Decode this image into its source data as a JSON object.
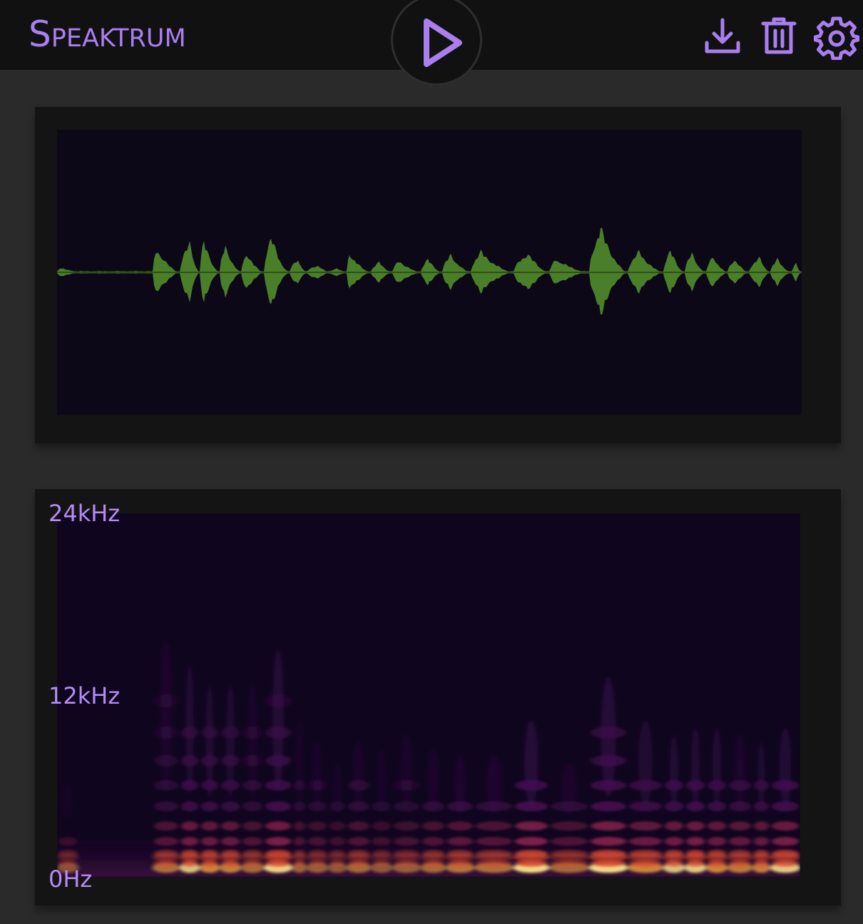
{
  "app": {
    "title": "Speaktrum"
  },
  "toolbar": {
    "play_icon": "play-icon",
    "download_icon": "download-icon",
    "delete_icon": "trash-icon",
    "settings_icon": "gear-icon"
  },
  "spectrogram": {
    "freq_labels": {
      "top": "24kHz",
      "mid": "12kHz",
      "bottom": "0Hz"
    }
  },
  "colors": {
    "accent": "#a97ff0",
    "header_bg": "#111111",
    "page_bg": "#2a2a2a",
    "panel_bg": "#141414",
    "plot_bg": "#0d0818",
    "waveform": "#4f8a2b"
  }
}
